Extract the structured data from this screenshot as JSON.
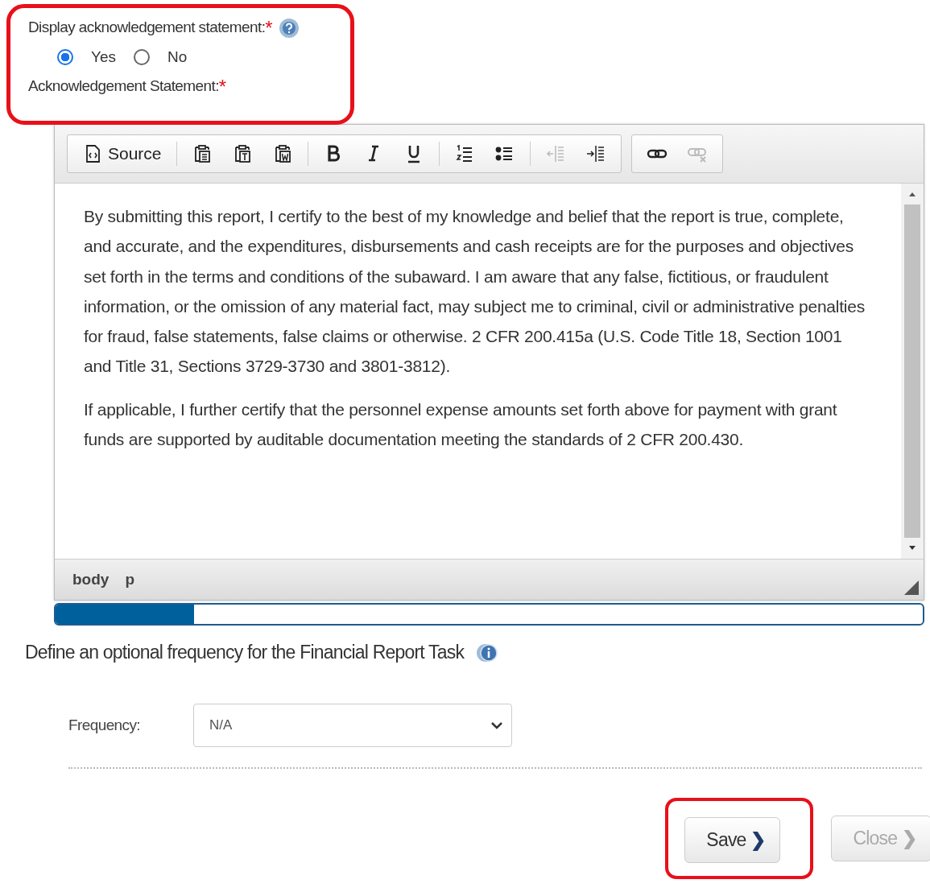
{
  "acknowledgement": {
    "highlighted": true,
    "display_label": "Display acknowledgement statement:",
    "required_mark": "*",
    "options": [
      {
        "label": "Yes",
        "selected": true
      },
      {
        "label": "No",
        "selected": false
      }
    ],
    "statement_label": "Acknowledgement Statement:",
    "statement_required_mark": "*"
  },
  "editor": {
    "toolbar": [
      {
        "items": [
          {
            "kind": "source",
            "label": "Source",
            "disabled": false
          },
          {
            "kind": "separator"
          },
          {
            "kind": "paste",
            "disabled": false
          },
          {
            "kind": "paste-text",
            "disabled": false
          },
          {
            "kind": "paste-word",
            "disabled": false
          },
          {
            "kind": "separator"
          },
          {
            "kind": "bold",
            "disabled": false
          },
          {
            "kind": "italic",
            "disabled": false
          },
          {
            "kind": "underline",
            "disabled": false
          },
          {
            "kind": "separator"
          },
          {
            "kind": "numbered-list",
            "disabled": false
          },
          {
            "kind": "bulleted-list",
            "disabled": false
          },
          {
            "kind": "separator"
          },
          {
            "kind": "outdent",
            "disabled": true
          },
          {
            "kind": "indent",
            "disabled": false
          }
        ]
      },
      {
        "items": [
          {
            "kind": "link",
            "disabled": false
          },
          {
            "kind": "unlink",
            "disabled": true
          }
        ]
      }
    ],
    "paragraphs": [
      "By submitting this report, I certify to the best of my knowledge and belief that the report is true, complete, and accurate, and the expenditures, disbursements and cash receipts are for the purposes and objectives set forth in the terms and conditions of the subaward. I am aware that any false, fictitious, or fraudulent information, or the omission of any material fact, may subject me to criminal, civil or administrative penalties for fraud, false statements, false claims or otherwise.  2 CFR 200.415a (U.S. Code Title 18, Section 1001 and Title 31, Sections 3729-3730 and 3801-3812).",
      "If applicable, I further certify that the personnel expense amounts set forth above for payment with grant funds are supported by auditable documentation meeting the standards of 2 CFR 200.430."
    ],
    "path": [
      "body",
      "p"
    ]
  },
  "progress": {
    "level": 0.16
  },
  "frequency_section": {
    "title": "Define an optional frequency for the Financial Report Task",
    "label": "Frequency:",
    "value": "N/A"
  },
  "buttons": [
    {
      "label": "Save",
      "chevron": "❯",
      "disabled": false,
      "highlighted": true
    },
    {
      "label": "Close",
      "chevron": "❯",
      "disabled": true,
      "highlighted": false
    }
  ]
}
